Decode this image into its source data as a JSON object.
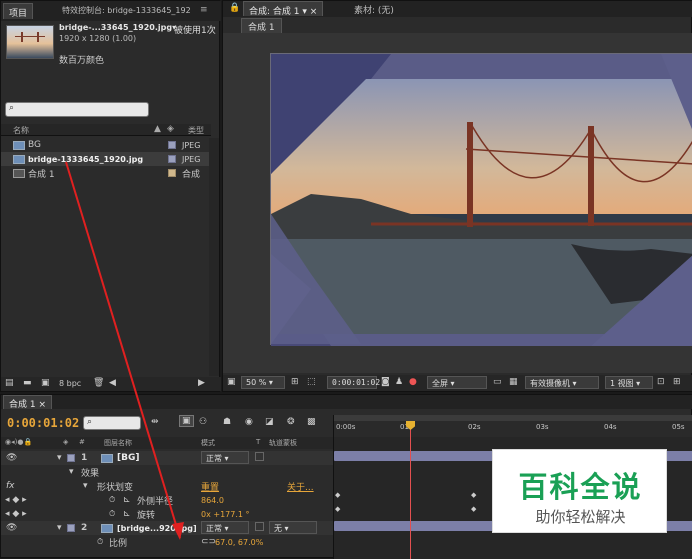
{
  "project_panel": {
    "tab_project": "项目",
    "tab_effects": "特效控制台: bridge-1333645_192",
    "file_name": "bridge-...33645_1920.jpg▾",
    "used_count": "被使用1次",
    "dims": "1920 x 1280 (1.00)",
    "colors": "数百万颜色",
    "col_name": "名称",
    "col_type": "类型",
    "items": [
      {
        "name": "BG",
        "type": "JPEG",
        "color": "#9aa0bd"
      },
      {
        "name": "bridge-1333645_1920.jpg",
        "type": "JPEG",
        "color": "#9aa0bd"
      },
      {
        "name": "合成 1",
        "type": "合成",
        "color": "#d0b88c"
      }
    ],
    "bpc": "8 bpc"
  },
  "composition_panel": {
    "tab_comp": "合成: 合成 1",
    "tab_footage": "素材: (无)",
    "subtab": "合成 1",
    "zoom": "50 %",
    "timecode": "0:00:01:02",
    "resolution": "全屏",
    "camera": "有效摄像机",
    "view": "1 视图"
  },
  "timeline_panel": {
    "tab": "合成 1",
    "timecode": "0:00:01:02",
    "col_num": "#",
    "col_layer": "图层名称",
    "col_mode": "模式",
    "col_t": "T",
    "col_trkmat": "轨道蒙板",
    "ruler": [
      "0:00s",
      "01s",
      "02s",
      "03s",
      "04s",
      "05s"
    ],
    "layers": [
      {
        "num": "1",
        "name": "[BG]",
        "mode": "正常"
      },
      {
        "num": "2",
        "name": "[bridge...920.jpg]",
        "mode": "正常",
        "trkmat": "无"
      }
    ],
    "effects_label": "效果",
    "effect_name": "形状划变",
    "reset": "重置",
    "about": "关于...",
    "prop_radius": "外侧半径",
    "radius_val": "864.0",
    "prop_rotation": "旋转",
    "rotation_val": "0x +177.1 °",
    "prop_scale": "比例",
    "scale_val": "67.0, 67.0%"
  },
  "watermark": {
    "line1": "百科全说",
    "line2": "助你轻松解决"
  }
}
